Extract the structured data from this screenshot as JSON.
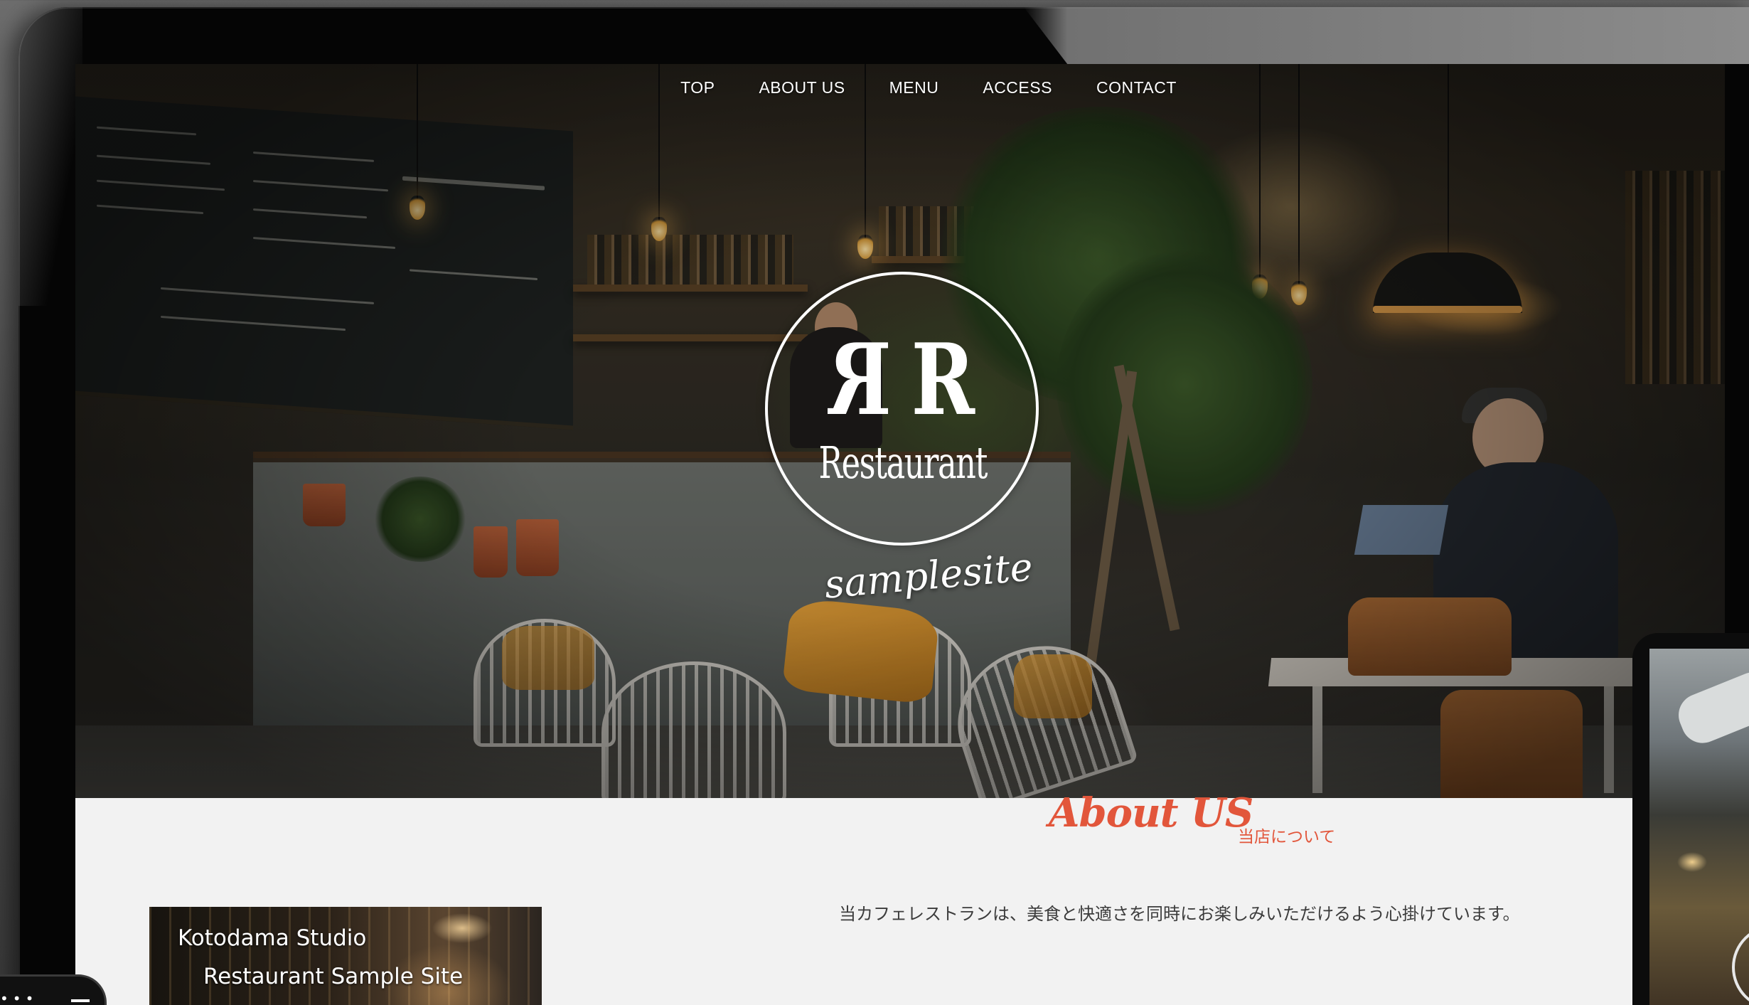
{
  "nav": {
    "items": [
      {
        "label": "TOP"
      },
      {
        "label": "ABOUT US"
      },
      {
        "label": "MENU"
      },
      {
        "label": "ACCESS"
      },
      {
        "label": "CONTACT"
      }
    ]
  },
  "hero": {
    "logo_word": "Restaurant",
    "tagline": "samplesite"
  },
  "about": {
    "title": "About US",
    "subtitle": "当店について",
    "body": "当カフェレストランは、美食と快適さを同時にお楽しみいただけるよう心掛けています。"
  },
  "thumbnail": {
    "line1": "Kotodama Studio",
    "line2": "Restaurant Sample Site"
  },
  "phone": {
    "status_dots": "•••"
  },
  "colors": {
    "accent": "#e2563b",
    "nav_text": "#ffffff",
    "body_text": "#3c3c3c",
    "section_bg": "#f2f2f2"
  }
}
